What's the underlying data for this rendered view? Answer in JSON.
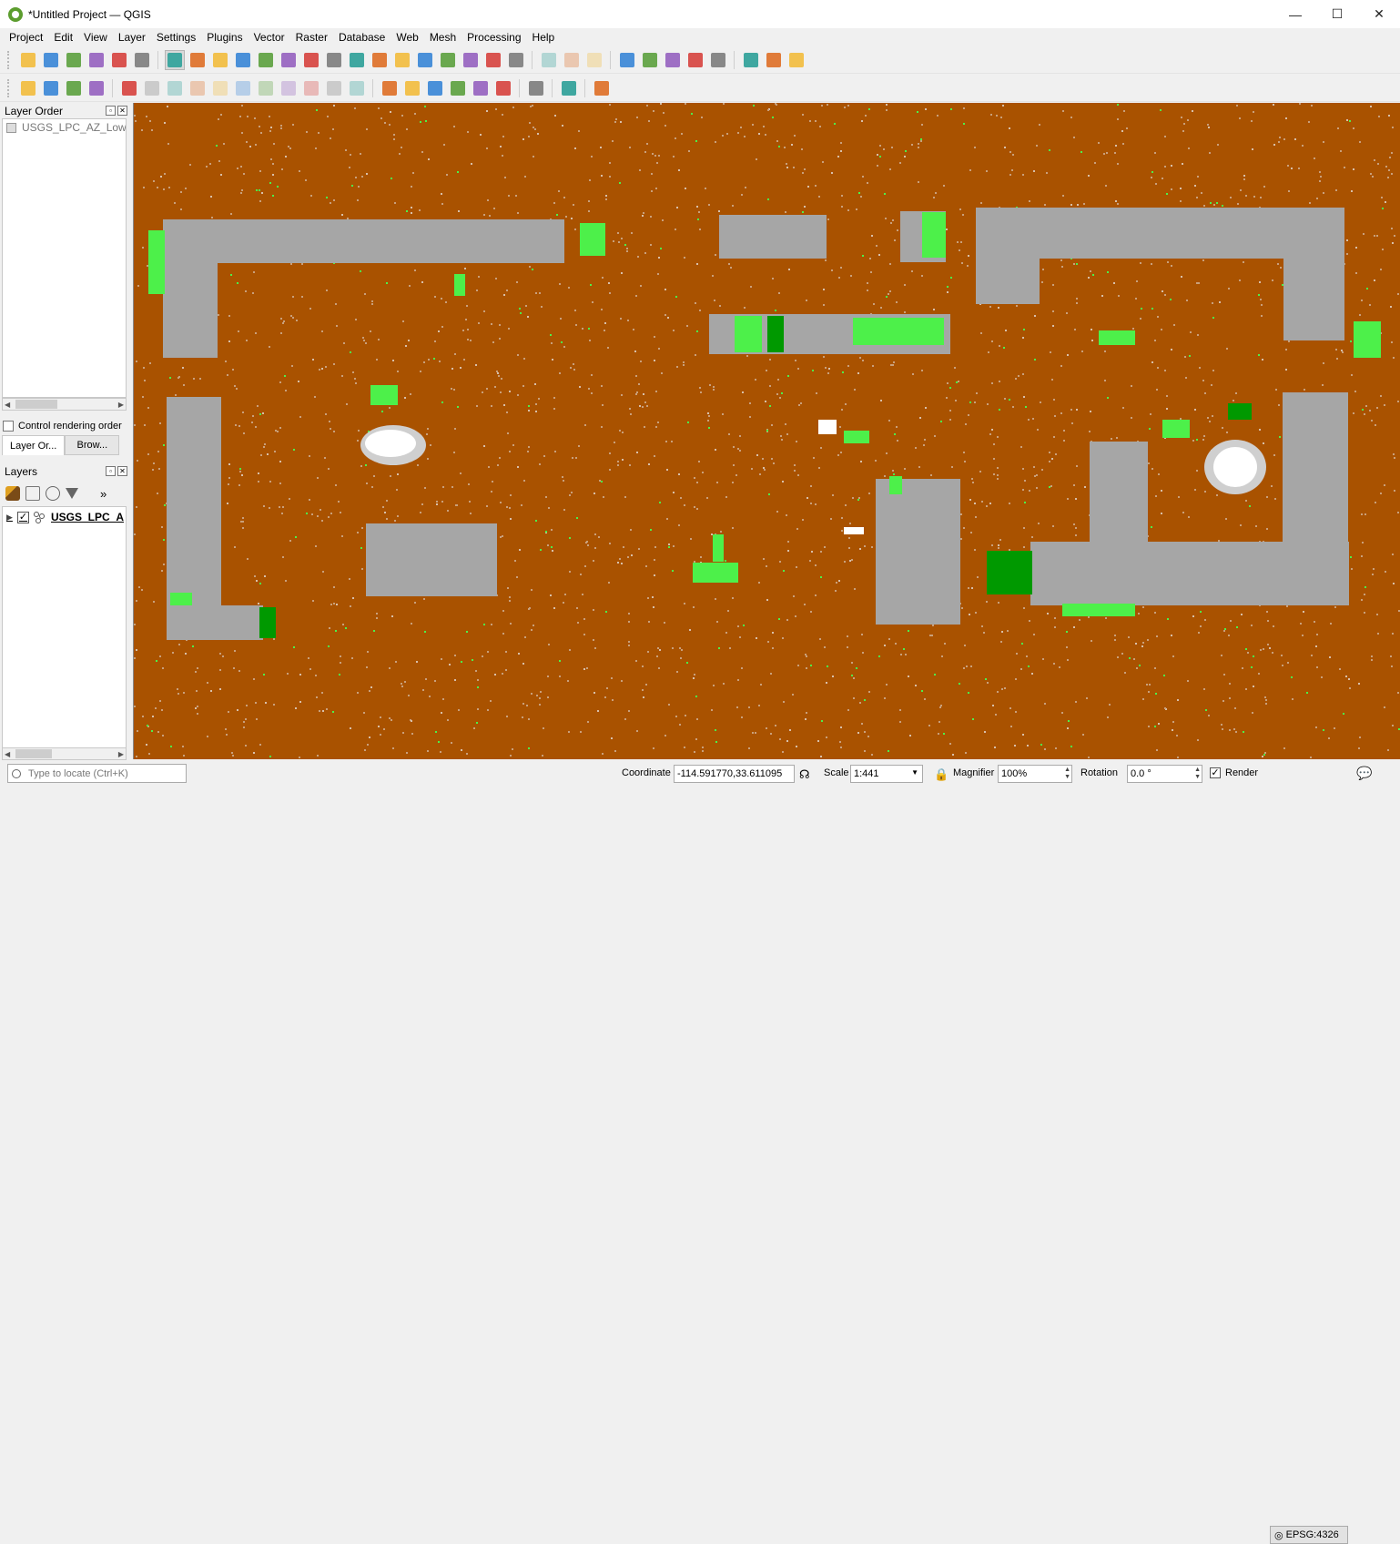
{
  "window": {
    "title": "*Untitled Project — QGIS",
    "controls": {
      "minimize": "—",
      "maximize": "☐",
      "close": "✕"
    }
  },
  "menu": [
    "Project",
    "Edit",
    "View",
    "Layer",
    "Settings",
    "Plugins",
    "Vector",
    "Raster",
    "Database",
    "Web",
    "Mesh",
    "Processing",
    "Help"
  ],
  "toolbar_icons": {
    "row1": [
      "new-project-icon",
      "open-project-icon",
      "save-project-icon",
      "save-as-icon",
      "print-layout-icon",
      "style-manager-icon",
      "pan-hand-icon",
      "pan-to-selection-icon",
      "zoom-in-icon",
      "zoom-out-icon",
      "zoom-full-icon",
      "zoom-selection-icon",
      "zoom-layer-icon",
      "zoom-native-icon",
      "zoom-last-icon",
      "zoom-next-icon",
      "new-map-view-icon",
      "new-3d-view-icon",
      "temporal-controller-icon",
      "new-bookmark-icon",
      "show-bookmarks-icon",
      "refresh-icon",
      "select-features-icon",
      "select-value-icon",
      "deselect-icon",
      "identify-icon",
      "attribute-table-icon",
      "toolbox-icon",
      "statistics-icon",
      "field-calculator-icon",
      "measure-icon",
      "map-tips-icon",
      "annotation-icon"
    ],
    "row2": [
      "add-data-source-icon",
      "add-layer-icon",
      "new-geopackage-icon",
      "new-shapefile-icon",
      "digitize-icon",
      "save-edits-icon",
      "toggle-editing-icon",
      "add-feature-icon",
      "vertex-tool-icon",
      "delete-selected-icon",
      "cut-features-icon",
      "copy-features-icon",
      "paste-features-icon",
      "undo-icon",
      "redo-icon",
      "label-tool-icon",
      "pin-labels-icon",
      "highlight-labels-icon",
      "move-label-icon",
      "rotate-label-icon",
      "change-label-icon",
      "plugin-manager-icon",
      "python-console-icon",
      "help-icon"
    ]
  },
  "layer_order_panel": {
    "title": "Layer Order",
    "item": "USGS_LPC_AZ_LowerC",
    "control_rendering_order": "Control rendering order",
    "tabs": [
      "Layer Or...",
      "Brow..."
    ]
  },
  "layers_panel": {
    "title": "Layers",
    "layer_name": "USGS_LPC_A",
    "checked_mark": "✓",
    "more": "»"
  },
  "map": {
    "ground_color": "#a95200",
    "building_color": "#a6a6a6",
    "vegetation_bright": "#4df04a",
    "vegetation_dark": "#009900",
    "water_color": "#ffffff"
  },
  "status": {
    "locate_placeholder": "Type to locate (Ctrl+K)",
    "coordinate_label": "Coordinate",
    "coordinate_value": "-114.591770,33.611095",
    "scale_label": "Scale",
    "scale_value": "1:441",
    "magnifier_label": "Magnifier",
    "magnifier_value": "100%",
    "rotation_label": "Rotation",
    "rotation_value": "0.0 °",
    "render_label": "Render",
    "render_checked": "✓",
    "crs": "EPSG:4326"
  }
}
